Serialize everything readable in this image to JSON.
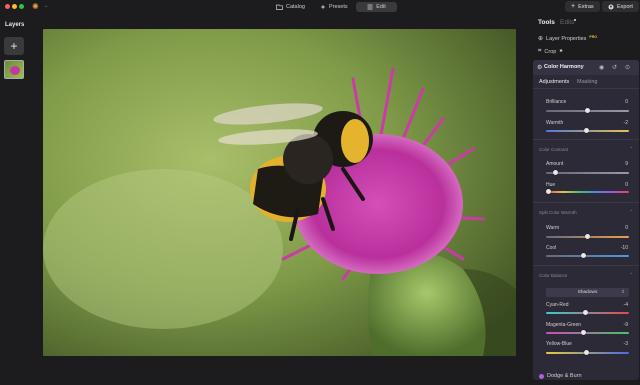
{
  "header": {
    "nav": [
      {
        "icon": "folder-icon",
        "label": "Catalog"
      },
      {
        "icon": "presets-icon",
        "label": "Presets"
      },
      {
        "icon": "edit-sliders-icon",
        "label": "Edit",
        "active": true
      }
    ],
    "extras_label": "Extras",
    "export_label": "Export"
  },
  "layers": {
    "title": "Layers",
    "add_icon": "plus-icon"
  },
  "tools_panel": {
    "tabs": [
      {
        "label": "Tools",
        "active": true
      },
      {
        "label": "Edits",
        "active": false
      }
    ],
    "items": [
      {
        "label": "Layer Properties",
        "badge": "PRO"
      },
      {
        "label": "Crop",
        "badge": ""
      }
    ],
    "color_harmony": {
      "title": "Color Harmony",
      "subtabs": [
        "Adjustments",
        "Masking"
      ],
      "sections": [
        {
          "name": "",
          "sliders": [
            {
              "label": "Brilliance",
              "value": "0",
              "level": 0.5
            },
            {
              "label": "Warmth",
              "value": "-2",
              "level": 0.49
            }
          ]
        },
        {
          "name": "Color Contrast",
          "sliders": [
            {
              "label": "Amount",
              "value": "9",
              "level": 0.09
            },
            {
              "label": "Hue",
              "value": "0",
              "level": 0.0
            }
          ]
        },
        {
          "name": "Split Color Warmth",
          "sliders": [
            {
              "label": "Warm",
              "value": "0",
              "level": 0.5
            },
            {
              "label": "Cool",
              "value": "-10",
              "level": 0.45
            }
          ]
        },
        {
          "name": "Color Balance",
          "dropdown": "Shadows",
          "sliders": [
            {
              "label": "Cyan-Red",
              "value": "-4",
              "level": 0.48
            },
            {
              "label": "Magenta-Green",
              "value": "-9",
              "level": 0.455
            },
            {
              "label": "Yellow-Blue",
              "value": "-3",
              "level": 0.485
            }
          ]
        }
      ]
    },
    "dodge_burn": {
      "label": "Dodge & Burn"
    }
  },
  "colors": {
    "accent": "#e8a33c",
    "panel_bg": "#2b2a36"
  }
}
